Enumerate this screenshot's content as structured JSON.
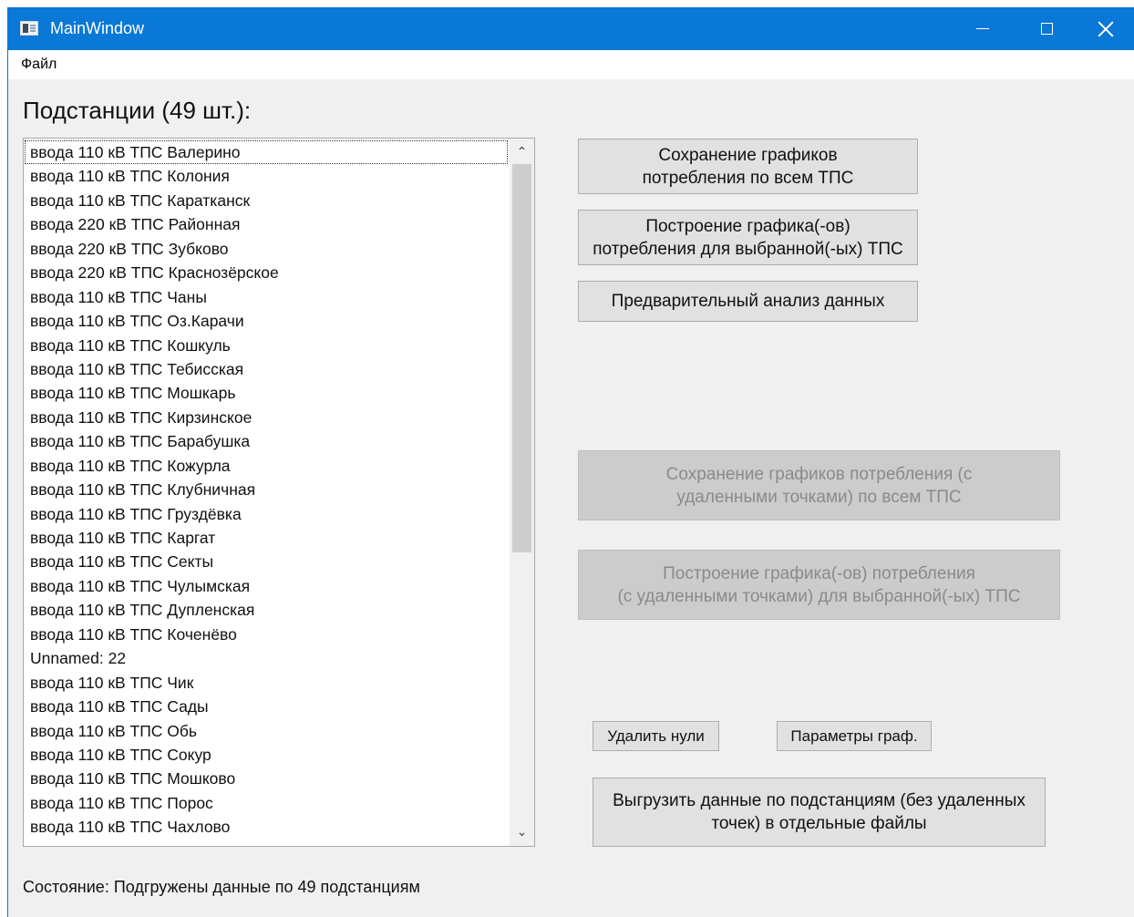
{
  "window": {
    "title": "MainWindow",
    "icon": "app-window-icon"
  },
  "menu": {
    "items": [
      "Файл"
    ]
  },
  "stations": {
    "header": "Подстанции (49 шт.):",
    "items": [
      "ввода 110 кВ ТПС Валерино",
      "ввода 110 кВ ТПС Колония",
      "ввода 110 кВ ТПС Каратканск",
      "ввода 220 кВ ТПС Районная",
      "ввода 220 кВ ТПС Зубково",
      "ввода 220 кВ ТПС Краснозёрское",
      "ввода 110 кВ ТПС Чаны",
      "ввода 110 кВ ТПС Оз.Карачи",
      "ввода 110 кВ ТПС Кошкуль",
      "ввода 110 кВ ТПС Тебисская",
      "ввода 110 кВ ТПС Мошкарь",
      "ввода 110 кВ ТПС Кирзинское",
      "ввода 110 кВ ТПС Барабушка",
      "ввода 110 кВ ТПС Кожурла",
      "ввода 110 кВ ТПС Клубничная",
      "ввода 110 кВ ТПС Груздёвка",
      "ввода 110 кВ ТПС Каргат",
      "ввода 110 кВ ТПС Секты",
      "ввода 110 кВ ТПС Чулымская",
      "ввода 110 кВ ТПС Дупленская",
      "ввода 110 кВ ТПС Коченёво",
      "Unnamed: 22",
      "ввода 110 кВ ТПС Чик",
      "ввода 110 кВ ТПС Сады",
      "ввода 110 кВ ТПС Обь",
      "ввода 110 кВ ТПС Сокур",
      "ввода 110 кВ ТПС Мошково",
      "ввода 110 кВ ТПС Порос",
      "ввода 110 кВ ТПС Чахлово"
    ]
  },
  "buttons": {
    "save_all": "Сохранение графиков\nпотребления по всем ТПС",
    "plot_selected": "Построение графика(-ов)\nпотребления для выбранной(-ых) ТПС",
    "preliminary": "Предварительный анализ данных",
    "save_removed": "Сохранение графиков потребления (с\nудаленными точками) по всем ТПС",
    "plot_removed": "Построение графика(-ов) потребления\n(с удаленными точками) для выбранной(-ых) ТПС",
    "delete_zeros": "Удалить нули",
    "plot_params": "Параметры граф.",
    "export": "Выгрузить данные по подстанциям (без удаленных\nточек) в отдельные файлы"
  },
  "status": "Состояние: Подгружены данные по 49 подстанциям"
}
